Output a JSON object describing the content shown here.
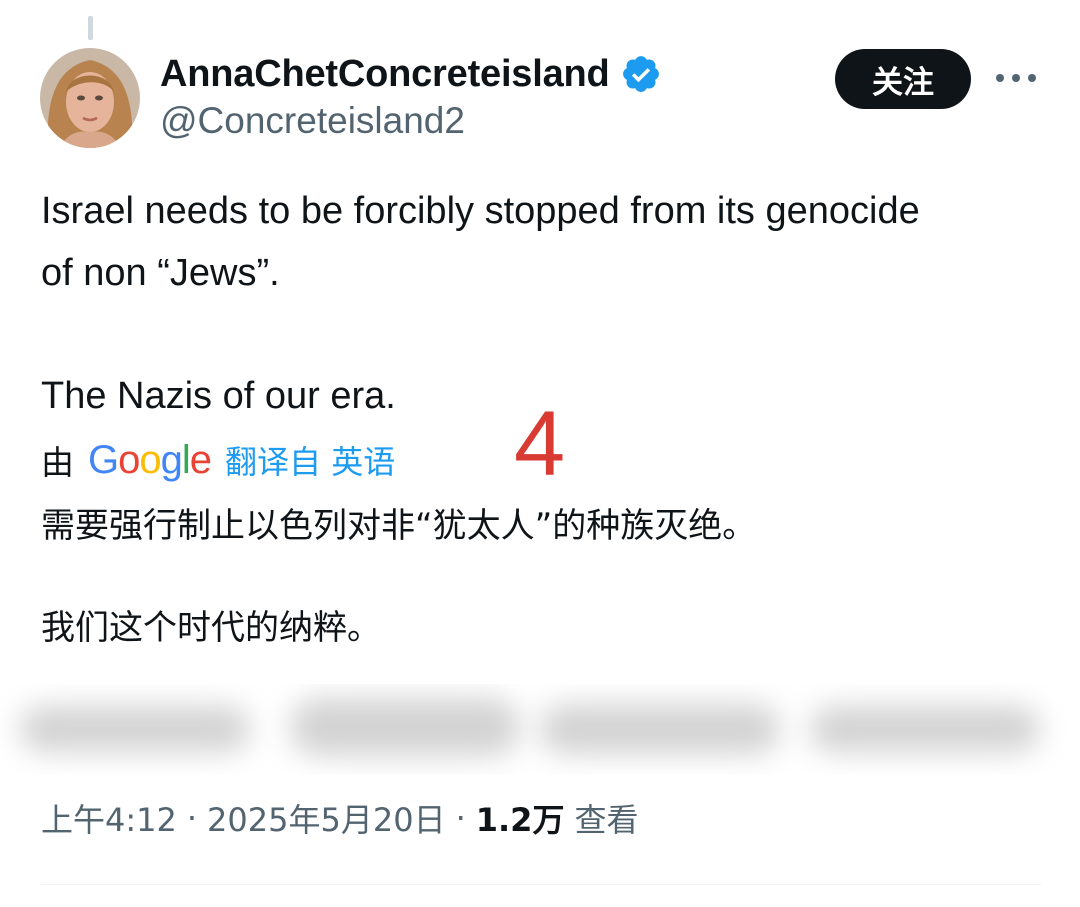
{
  "author": {
    "display_name": "AnnaChetConcreteisland",
    "handle": "@Concreteisland2",
    "verified": true
  },
  "header": {
    "follow_label": "关注"
  },
  "tweet": {
    "lines": [
      "Israel needs to be forcibly stopped from its genocide",
      "of non “Jews”.",
      "",
      "The Nazis of our era."
    ]
  },
  "translation": {
    "by_label": "由",
    "provider_letters": [
      "G",
      "o",
      "o",
      "g",
      "l",
      "e"
    ],
    "link_label": "翻译自 英语",
    "lines": [
      "需要强行制止以色列对非“犹太人”的种族灭绝。",
      "我们这个时代的纳粹。"
    ]
  },
  "annotation": {
    "number": "4"
  },
  "meta": {
    "time": "上午4:12",
    "separator": "·",
    "date": "2025年5月20日",
    "view_count": "1.2万",
    "views_label": "查看"
  },
  "icons": {
    "verified": "verified-badge-icon",
    "more": "more-dots-icon"
  },
  "colors": {
    "text_primary": "#0f1419",
    "text_secondary": "#536471",
    "accent": "#1d9bf0",
    "follow_button_bg": "#0f1419",
    "annotation": "#d93a32"
  }
}
